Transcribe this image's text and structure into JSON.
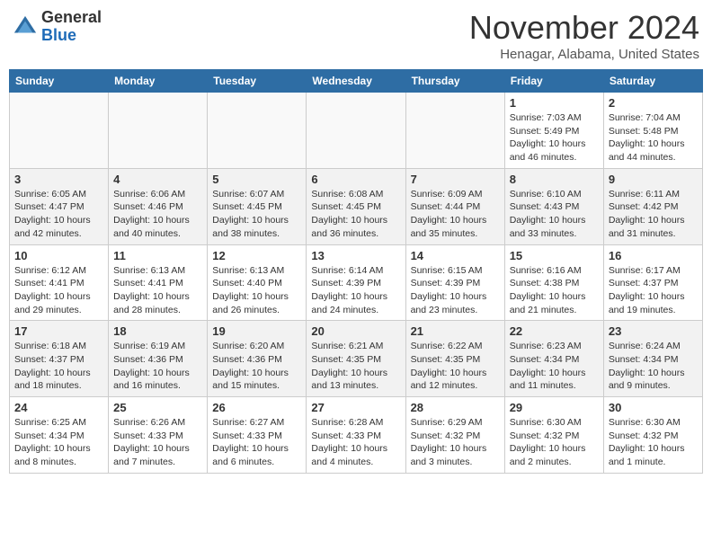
{
  "header": {
    "logo_line1": "General",
    "logo_line2": "Blue",
    "month": "November 2024",
    "location": "Henagar, Alabama, United States"
  },
  "weekdays": [
    "Sunday",
    "Monday",
    "Tuesday",
    "Wednesday",
    "Thursday",
    "Friday",
    "Saturday"
  ],
  "weeks": [
    [
      {
        "day": "",
        "info": ""
      },
      {
        "day": "",
        "info": ""
      },
      {
        "day": "",
        "info": ""
      },
      {
        "day": "",
        "info": ""
      },
      {
        "day": "",
        "info": ""
      },
      {
        "day": "1",
        "info": "Sunrise: 7:03 AM\nSunset: 5:49 PM\nDaylight: 10 hours\nand 46 minutes."
      },
      {
        "day": "2",
        "info": "Sunrise: 7:04 AM\nSunset: 5:48 PM\nDaylight: 10 hours\nand 44 minutes."
      }
    ],
    [
      {
        "day": "3",
        "info": "Sunrise: 6:05 AM\nSunset: 4:47 PM\nDaylight: 10 hours\nand 42 minutes."
      },
      {
        "day": "4",
        "info": "Sunrise: 6:06 AM\nSunset: 4:46 PM\nDaylight: 10 hours\nand 40 minutes."
      },
      {
        "day": "5",
        "info": "Sunrise: 6:07 AM\nSunset: 4:45 PM\nDaylight: 10 hours\nand 38 minutes."
      },
      {
        "day": "6",
        "info": "Sunrise: 6:08 AM\nSunset: 4:45 PM\nDaylight: 10 hours\nand 36 minutes."
      },
      {
        "day": "7",
        "info": "Sunrise: 6:09 AM\nSunset: 4:44 PM\nDaylight: 10 hours\nand 35 minutes."
      },
      {
        "day": "8",
        "info": "Sunrise: 6:10 AM\nSunset: 4:43 PM\nDaylight: 10 hours\nand 33 minutes."
      },
      {
        "day": "9",
        "info": "Sunrise: 6:11 AM\nSunset: 4:42 PM\nDaylight: 10 hours\nand 31 minutes."
      }
    ],
    [
      {
        "day": "10",
        "info": "Sunrise: 6:12 AM\nSunset: 4:41 PM\nDaylight: 10 hours\nand 29 minutes."
      },
      {
        "day": "11",
        "info": "Sunrise: 6:13 AM\nSunset: 4:41 PM\nDaylight: 10 hours\nand 28 minutes."
      },
      {
        "day": "12",
        "info": "Sunrise: 6:13 AM\nSunset: 4:40 PM\nDaylight: 10 hours\nand 26 minutes."
      },
      {
        "day": "13",
        "info": "Sunrise: 6:14 AM\nSunset: 4:39 PM\nDaylight: 10 hours\nand 24 minutes."
      },
      {
        "day": "14",
        "info": "Sunrise: 6:15 AM\nSunset: 4:39 PM\nDaylight: 10 hours\nand 23 minutes."
      },
      {
        "day": "15",
        "info": "Sunrise: 6:16 AM\nSunset: 4:38 PM\nDaylight: 10 hours\nand 21 minutes."
      },
      {
        "day": "16",
        "info": "Sunrise: 6:17 AM\nSunset: 4:37 PM\nDaylight: 10 hours\nand 19 minutes."
      }
    ],
    [
      {
        "day": "17",
        "info": "Sunrise: 6:18 AM\nSunset: 4:37 PM\nDaylight: 10 hours\nand 18 minutes."
      },
      {
        "day": "18",
        "info": "Sunrise: 6:19 AM\nSunset: 4:36 PM\nDaylight: 10 hours\nand 16 minutes."
      },
      {
        "day": "19",
        "info": "Sunrise: 6:20 AM\nSunset: 4:36 PM\nDaylight: 10 hours\nand 15 minutes."
      },
      {
        "day": "20",
        "info": "Sunrise: 6:21 AM\nSunset: 4:35 PM\nDaylight: 10 hours\nand 13 minutes."
      },
      {
        "day": "21",
        "info": "Sunrise: 6:22 AM\nSunset: 4:35 PM\nDaylight: 10 hours\nand 12 minutes."
      },
      {
        "day": "22",
        "info": "Sunrise: 6:23 AM\nSunset: 4:34 PM\nDaylight: 10 hours\nand 11 minutes."
      },
      {
        "day": "23",
        "info": "Sunrise: 6:24 AM\nSunset: 4:34 PM\nDaylight: 10 hours\nand 9 minutes."
      }
    ],
    [
      {
        "day": "24",
        "info": "Sunrise: 6:25 AM\nSunset: 4:34 PM\nDaylight: 10 hours\nand 8 minutes."
      },
      {
        "day": "25",
        "info": "Sunrise: 6:26 AM\nSunset: 4:33 PM\nDaylight: 10 hours\nand 7 minutes."
      },
      {
        "day": "26",
        "info": "Sunrise: 6:27 AM\nSunset: 4:33 PM\nDaylight: 10 hours\nand 6 minutes."
      },
      {
        "day": "27",
        "info": "Sunrise: 6:28 AM\nSunset: 4:33 PM\nDaylight: 10 hours\nand 4 minutes."
      },
      {
        "day": "28",
        "info": "Sunrise: 6:29 AM\nSunset: 4:32 PM\nDaylight: 10 hours\nand 3 minutes."
      },
      {
        "day": "29",
        "info": "Sunrise: 6:30 AM\nSunset: 4:32 PM\nDaylight: 10 hours\nand 2 minutes."
      },
      {
        "day": "30",
        "info": "Sunrise: 6:30 AM\nSunset: 4:32 PM\nDaylight: 10 hours\nand 1 minute."
      }
    ]
  ]
}
